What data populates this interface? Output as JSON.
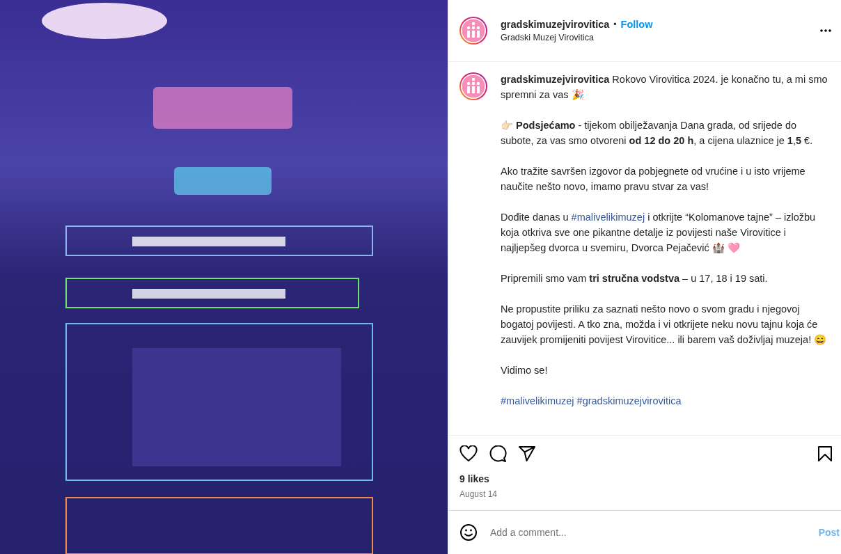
{
  "header": {
    "username": "gradskimuzejvirovitica",
    "separator": "•",
    "follow": "Follow",
    "subtitle": "Gradski Muzej Virovitica"
  },
  "caption": {
    "paragraphs": [
      {
        "parts": [
          {
            "kind": "user",
            "text": "gradskimuzejvirovitica"
          },
          {
            "kind": "text",
            "text": " Rokovo Virovitica 2024. je konačno tu, a mi smo spremni za vas 🎉"
          }
        ]
      },
      {
        "parts": [
          {
            "kind": "text",
            "text": "👉🏻 **Podsjećamo** - tijekom obilježavanja Dana grada, od srijede do subote, za vas smo otvoreni **od 12 do 20 h**, a cijena ulaznice je **1**,**5** €."
          }
        ]
      },
      {
        "parts": [
          {
            "kind": "text",
            "text": "Ako tražite savršen izgovor da pobjegnete od vrućine i u isto vrijeme naučite nešto novo, imamo pravu stvar za vas!"
          }
        ]
      },
      {
        "parts": [
          {
            "kind": "text",
            "text": "Dođite danas u "
          },
          {
            "kind": "hashtag",
            "text": "#malivelikimuzej"
          },
          {
            "kind": "text",
            "text": " i otkrijte “Kolomanove tajne” – izložbu koja otkriva sve one pikantne detalje iz povijesti naše Virovitice i najljepšeg dvorca u svemiru, Dvorca Pejačević 🏰 🩷"
          }
        ]
      },
      {
        "parts": [
          {
            "kind": "text",
            "text": "Pripremili smo vam **tri stručna vodstva** – u 17, 18 i 19 sati."
          }
        ]
      },
      {
        "parts": [
          {
            "kind": "text",
            "text": "Ne propustite priliku za saznati nešto novo o svom gradu i njegovoj bogatoj povijesti. A tko zna, možda i vi otkrijete neku novu tajnu koja će zauvijek promijeniti povijest Virovitice... ili barem vaš doživljaj muzeja! 😄"
          }
        ]
      },
      {
        "parts": [
          {
            "kind": "text",
            "text": "Vidimo se!"
          }
        ]
      },
      {
        "parts": [
          {
            "kind": "hashtag",
            "text": "#malivelikimuzej"
          },
          {
            "kind": "hashtag",
            "text": "#gradskimuzejvirovitica"
          }
        ]
      }
    ]
  },
  "actions": {
    "liked": false,
    "saved": false
  },
  "likes": "9 likes",
  "date": "August 14",
  "comment": {
    "placeholder": "Add a comment...",
    "post": "Post",
    "disabled": true
  }
}
